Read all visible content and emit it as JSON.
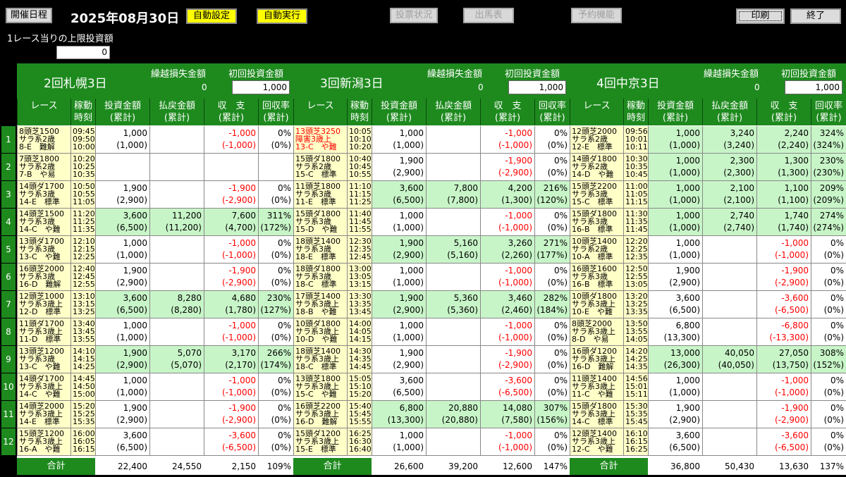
{
  "header": {
    "schedule_btn": "開催日程",
    "date": "2025年08月30日",
    "auto_set": "自動設定",
    "auto_run": "自動実行",
    "vote_status": "投票状況",
    "race_card": "出馬表",
    "reserve": "予約機能",
    "print": "印刷",
    "exit": "終了"
  },
  "limit": {
    "label": "1レース当りの上限投資額",
    "value": "0"
  },
  "colhead": {
    "race": "レース",
    "time": "稼動\n時刻",
    "invest": "投資金額\n(累計)",
    "payout": "払戻金額\n(累計)",
    "balance": "収　支\n(累計)",
    "rate": "回収率\n(累計)",
    "loss_label": "繰越損失金額",
    "init_label": "初回投資金額",
    "total": "合計"
  },
  "rownums": [
    "1",
    "2",
    "3",
    "4",
    "5",
    "6",
    "7",
    "8",
    "9",
    "10",
    "11",
    "12"
  ],
  "panels": [
    {
      "title": "2回札幌3日",
      "loss": "0",
      "init": "1,000",
      "races": [
        [
          "8頭芝1500\nサラ系2歳\n8-E　難解",
          "09:45\n09:50\n10:00",
          "1,000\n(1,000)",
          "",
          "-1,000\n(-1,000)",
          "0%\n(0%)",
          false
        ],
        [
          "7頭芝1800\nサラ系2歳\n7-B　や易",
          "10:20\n10:25\n10:35",
          "",
          "",
          "",
          "",
          false
        ],
        [
          "14頭ダ1700\nサラ系3歳\n14-E　標準",
          "10:50\n10:55\n11:05",
          "1,900\n(2,900)",
          "",
          "-1,900\n(-2,900)",
          "0%\n(0%)",
          false
        ],
        [
          "14頭芝1500\nサラ系3歳\n14-C　や難",
          "11:20\n11:25\n11:35",
          "3,600\n(6,500)",
          "11,200\n(11,200)",
          "7,600\n(4,700)",
          "311%\n(172%)",
          true
        ],
        [
          "13頭ダ1700\nサラ系3歳\n13-C　や難",
          "12:10\n12:15\n12:25",
          "1,000\n(1,000)",
          "",
          "-1,000\n(-1,000)",
          "0%\n(0%)",
          false
        ],
        [
          "16頭芝2000\nサラ系3歳\n16-D　難解",
          "12:40\n12:45\n12:55",
          "1,900\n(2,900)",
          "",
          "-1,900\n(-2,900)",
          "0%\n(0%)",
          false
        ],
        [
          "12頭芝1000\nサラ系3歳上\n12-D　標準",
          "13:10\n13:15\n13:25",
          "3,600\n(6,500)",
          "8,280\n(8,280)",
          "4,680\n(1,780)",
          "230%\n(127%)",
          true
        ],
        [
          "11頭ダ1700\nサラ系3歳上\n11-D　標準",
          "13:40\n13:45\n13:55",
          "1,000\n(1,000)",
          "",
          "-1,000\n(-1,000)",
          "0%\n(0%)",
          false
        ],
        [
          "13頭芝1200\nサラ系3歳\n13-C　や難",
          "14:10\n14:15\n14:25",
          "1,900\n(2,900)",
          "5,070\n(5,070)",
          "3,170\n(2,170)",
          "266%\n(174%)",
          true
        ],
        [
          "14頭ダ1700\nサラ系3歳上\n14-C　や難",
          "14:45\n14:50\n15:00",
          "1,000\n(1,000)",
          "",
          "-1,000\n(-1,000)",
          "0%\n(0%)",
          false
        ],
        [
          "14頭芝2000\nサラ系3歳上\n14-E　標準",
          "15:20\n15:25\n15:35",
          "1,900\n(2,900)",
          "",
          "-1,900\n(-2,900)",
          "0%\n(0%)",
          false
        ],
        [
          "15頭芝1200\nサラ系3歳上\n16-A　や難",
          "16:00\n16:05\n16:15",
          "3,600\n(6,500)",
          "",
          "-3,600\n(-6,500)",
          "0%\n(0%)",
          false
        ]
      ],
      "total": [
        "22,400",
        "24,550",
        "2,150",
        "109%"
      ]
    },
    {
      "title": "3回新潟3日",
      "loss": "0",
      "init": "1,000",
      "races": [
        [
          "13頭芝3250\n障害3歳上\n13-C　や難",
          "10:05\n10:10\n10:20",
          "1,000\n(1,000)",
          "",
          "-1,000\n(-1,000)",
          "0%\n(0%)",
          false,
          true
        ],
        [
          "15頭ダ1800\nサラ系2歳\n15-C　標準",
          "10:40\n10:45\n10:55",
          "1,900\n(2,900)",
          "",
          "-1,900\n(-2,900)",
          "0%\n(0%)",
          false
        ],
        [
          "11頭芝1800\nサラ系3歳\n11-E　標準",
          "11:10\n11:15\n11:25",
          "3,600\n(6,500)",
          "7,800\n(7,800)",
          "4,200\n(1,300)",
          "216%\n(120%)",
          true
        ],
        [
          "15頭ダ1800\nサラ系3歳\n15-D　や難",
          "11:40\n11:45\n11:55",
          "1,000\n(1,000)",
          "",
          "-1,000\n(-1,000)",
          "0%\n(0%)",
          false
        ],
        [
          "18頭芝1400\nサラ系3歳\n18-E　標準",
          "12:30\n12:35\n12:45",
          "1,900\n(2,900)",
          "5,160\n(5,160)",
          "3,260\n(2,260)",
          "271%\n(177%)",
          true
        ],
        [
          "18頭ダ1800\nサラ系3歳\n18-C　標準",
          "13:00\n13:05\n13:15",
          "1,000\n(1,000)",
          "",
          "-1,000\n(-1,000)",
          "0%\n(0%)",
          false
        ],
        [
          "17頭芝1400\nサラ系3歳上\n18-B　や難",
          "13:30\n13:35\n13:45",
          "1,900\n(2,900)",
          "5,360\n(5,360)",
          "3,460\n(2,460)",
          "282%\n(184%)",
          true
        ],
        [
          "10頭ダ1800\nサラ系3歳上\n10-D　や難",
          "14:00\n14:05\n14:15",
          "1,000\n(1,000)",
          "",
          "-1,000\n(-1,000)",
          "0%\n(0%)",
          false
        ],
        [
          "18頭芝1400\nサラ系3歳上\n18-C　標準",
          "14:30\n14:35\n14:45",
          "1,900\n(2,900)",
          "",
          "-1,900\n(-2,900)",
          "0%\n(0%)",
          false
        ],
        [
          "13頭芝1800\nサラ系3歳上\n15-C　や難",
          "15:05\n15:10\n15:20",
          "3,600\n(6,500)",
          "",
          "-3,600\n(-6,500)",
          "0%\n(0%)",
          false
        ],
        [
          "16頭芝2200\nサラ系3歳上\n16-D　難解",
          "15:40\n15:45\n15:55",
          "6,800\n(13,300)",
          "20,880\n(20,880)",
          "14,080\n(7,580)",
          "307%\n(156%)",
          true
        ],
        [
          "15頭ダ1200\nサラ系3歳上\n15-E　標準",
          "16:25\n16:30\n16:40",
          "1,000\n(1,000)",
          "",
          "-1,000\n(-1,000)",
          "0%\n(0%)",
          false
        ]
      ],
      "total": [
        "26,600",
        "39,200",
        "12,600",
        "147%"
      ]
    },
    {
      "title": "4回中京3日",
      "loss": "0",
      "init": "1,000",
      "races": [
        [
          "12頭芝2000\nサラ系2歳\n12-E　標準",
          "09:56\n10:01\n10:11",
          "1,000\n(1,000)",
          "3,240\n(3,240)",
          "2,240\n(2,240)",
          "324%\n(324%)",
          true
        ],
        [
          "14頭ダ1800\nサラ系2歳\n14-D　や難",
          "10:30\n10:35\n10:45",
          "1,000\n(1,000)",
          "2,300\n(2,300)",
          "1,300\n(1,300)",
          "230%\n(230%)",
          true
        ],
        [
          "15頭芝2200\nサラ系3歳\n15-C　標準",
          "11:00\n11:05\n11:15",
          "1,000\n(1,000)",
          "2,100\n(2,100)",
          "1,100\n(1,100)",
          "209%\n(209%)",
          true
        ],
        [
          "15頭ダ1800\nサラ系3歳\n16-B　標準",
          "11:30\n11:35\n11:45",
          "1,000\n(1,000)",
          "2,740\n(2,740)",
          "1,740\n(1,740)",
          "274%\n(274%)",
          true
        ],
        [
          "10頭芝1400\nサラ系2歳\n10-A　標準",
          "12:20\n12:25\n12:35",
          "1,000\n(1,000)",
          "",
          "-1,000\n(-1,000)",
          "0%\n(0%)",
          false
        ],
        [
          "16頭芝1600\nサラ系3歳\n16-B　標準",
          "12:50\n12:55\n13:05",
          "1,900\n(2,900)",
          "",
          "-1,900\n(-2,900)",
          "0%\n(0%)",
          false
        ],
        [
          "10頭ダ1800\nサラ系3歳上\n10-E　や難",
          "13:20\n13:25\n13:35",
          "3,600\n(6,500)",
          "",
          "-3,600\n(-6,500)",
          "0%\n(0%)",
          false
        ],
        [
          "8頭芝2000\nサラ系3歳上\n8-D　や易",
          "13:50\n13:55\n14:05",
          "6,800\n(13,300)",
          "",
          "-6,800\n(-13,300)",
          "0%\n(0%)",
          false
        ],
        [
          "16頭ダ1200\nサラ系3歳上\n16-D　難解",
          "14:20\n14:25\n14:35",
          "13,000\n(26,300)",
          "40,050\n(40,050)",
          "27,050\n(13,750)",
          "308%\n(152%)",
          true
        ],
        [
          "11頭芝1400\nサラ系3歳上\n11-C　や難",
          "14:56\n15:01\n15:11",
          "1,000\n(1,000)",
          "",
          "-1,000\n(-1,000)",
          "0%\n(0%)",
          false
        ],
        [
          "15頭ダ1800\nサラ系3歳上\n14-C　標準",
          "15:30\n15:35\n15:45",
          "1,900\n(2,900)",
          "",
          "-1,900\n(-2,900)",
          "0%\n(0%)",
          false
        ],
        [
          "12頭芝1400\nサラ系3歳上\n12-C　や難",
          "16:10\n16:15\n16:25",
          "3,600\n(6,500)",
          "",
          "-3,600\n(-6,500)",
          "0%\n(0%)",
          false
        ]
      ],
      "total": [
        "36,800",
        "50,430",
        "13,630",
        "137%"
      ]
    }
  ]
}
